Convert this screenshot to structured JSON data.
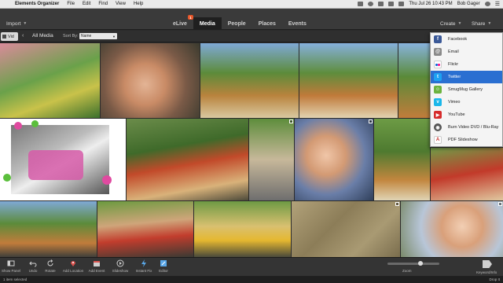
{
  "menubar": {
    "app_name": "Elements Organizer",
    "items": [
      "File",
      "Edit",
      "Find",
      "View",
      "Help"
    ],
    "clock": "Thu Jul 26  10:43 PM",
    "user": "Bob Gager"
  },
  "topbar": {
    "import_label": "Import",
    "create_label": "Create",
    "share_label": "Share",
    "modes": [
      {
        "label": "eLive",
        "badge": "1"
      },
      {
        "label": "Media"
      },
      {
        "label": "People"
      },
      {
        "label": "Places"
      },
      {
        "label": "Events"
      }
    ]
  },
  "subbar": {
    "vid_tab": "Vid",
    "all_media": "All Media",
    "sort_by_label": "Sort By:",
    "sort_value": "Name"
  },
  "share_menu": {
    "items": [
      {
        "label": "Facebook",
        "icon": "facebook-icon",
        "color": "#3b5998"
      },
      {
        "label": "Email",
        "icon": "email-icon",
        "color": "#8a8a8a"
      },
      {
        "label": "Flickr",
        "icon": "flickr-icon",
        "color": "#ff0084"
      },
      {
        "label": "Twitter",
        "icon": "twitter-icon",
        "color": "#1da1f2",
        "selected": true
      },
      {
        "label": "SmugMug Gallery",
        "icon": "smugmug-icon",
        "color": "#6cb33f"
      },
      {
        "label": "Vimeo",
        "icon": "vimeo-icon",
        "color": "#1ab7ea"
      },
      {
        "label": "YouTube",
        "icon": "youtube-icon",
        "color": "#d62b2b"
      },
      {
        "label": "Burn Video DVD / Blu-Ray",
        "icon": "disc-icon",
        "color": "#555555"
      },
      {
        "label": "PDF Slideshow",
        "icon": "pdf-icon",
        "color": "#c9302c"
      }
    ]
  },
  "actionbar": {
    "actions": [
      {
        "label": "Show Panel",
        "icon": "panel-icon"
      },
      {
        "label": "Undo",
        "icon": "undo-icon"
      },
      {
        "label": "Rotate",
        "icon": "rotate-icon"
      },
      {
        "label": "Add Location",
        "icon": "location-pin-icon"
      },
      {
        "label": "Add Event",
        "icon": "event-icon"
      },
      {
        "label": "Slideshow",
        "icon": "play-icon"
      },
      {
        "label": "Instant Fix",
        "icon": "lightning-icon"
      },
      {
        "label": "Editor",
        "icon": "editor-icon"
      }
    ],
    "zoom_label": "Zoom",
    "zoom_level": 0.65,
    "keyword_label": "Keyword/Info"
  },
  "statusbar": {
    "selected_text": "1 item selected",
    "drop_label": "Drop It"
  },
  "colors": {
    "accent": "#2a6fd1",
    "badge": "#e8572a",
    "background": "#2b2b2b"
  }
}
